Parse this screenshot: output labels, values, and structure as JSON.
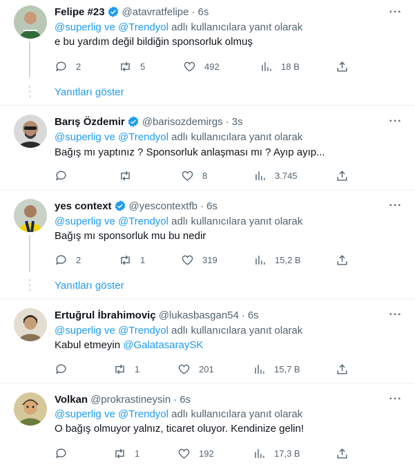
{
  "labels": {
    "replying_suffix": "adlı kullanıcılara yanıt olarak",
    "show_replies": "Yanıtları göster",
    "more": "···"
  },
  "tweets": [
    {
      "name": "Felipe #23",
      "verified": true,
      "handle": "@atavratfelipe",
      "time": "6s",
      "mentions": [
        "@superlig",
        "@Trendyol"
      ],
      "mention_joiner": "ve",
      "text": "e bu yardım değil bildiğin sponsorluk olmuş",
      "replies": "2",
      "retweets": "5",
      "likes": "492",
      "views": "18 B",
      "avatar_color": "#3f6b3a"
    },
    {
      "name": "Barış Özdemir",
      "verified": true,
      "handle": "@barisozdemirgs",
      "time": "3s",
      "mentions": [
        "@superlig",
        "@Trendyol"
      ],
      "mention_joiner": "ve",
      "text": "Bağış mı yaptınız ? Sponsorluk anlaşması mı ? Ayıp ayıp...",
      "replies": "",
      "retweets": "",
      "likes": "8",
      "views": "3.745",
      "avatar_color": "#5b5b5b"
    },
    {
      "name": "yes context",
      "verified": true,
      "handle": "@yescontextfb",
      "time": "6s",
      "mentions": [
        "@superlig",
        "@Trendyol"
      ],
      "mention_joiner": "ve",
      "text": "Bağış mı sponsorluk mu bu nedir",
      "replies": "2",
      "retweets": "1",
      "likes": "319",
      "views": "15,2 B",
      "avatar_color": "#2b3d5e"
    },
    {
      "name": "Ertuğrul İbrahimoviç",
      "verified": false,
      "handle": "@lukasbasgan54",
      "time": "6s",
      "mentions": [
        "@superlig",
        "@Trendyol"
      ],
      "mention_joiner": "ve",
      "text_prefix": "Kabul etmeyin ",
      "text_mention": "@GalatasaraySK",
      "replies": "",
      "retweets": "1",
      "likes": "201",
      "views": "15,7 B",
      "avatar_color": "#8a7a63"
    },
    {
      "name": "Volkan",
      "verified": false,
      "handle": "@prokrastineysin",
      "time": "6s",
      "mentions": [
        "@superlig",
        "@Trendyol"
      ],
      "mention_joiner": "ve",
      "text": "O bağış olmuyor yalnız, ticaret oluyor. Kendinize gelin!",
      "replies": "",
      "retweets": "1",
      "likes": "192",
      "views": "17,3 B",
      "avatar_color": "#6d7f4a"
    }
  ],
  "colors": {
    "accent": "#1d9bf0",
    "muted": "#536471",
    "text": "#0f1419",
    "divider": "#eff3f4"
  }
}
